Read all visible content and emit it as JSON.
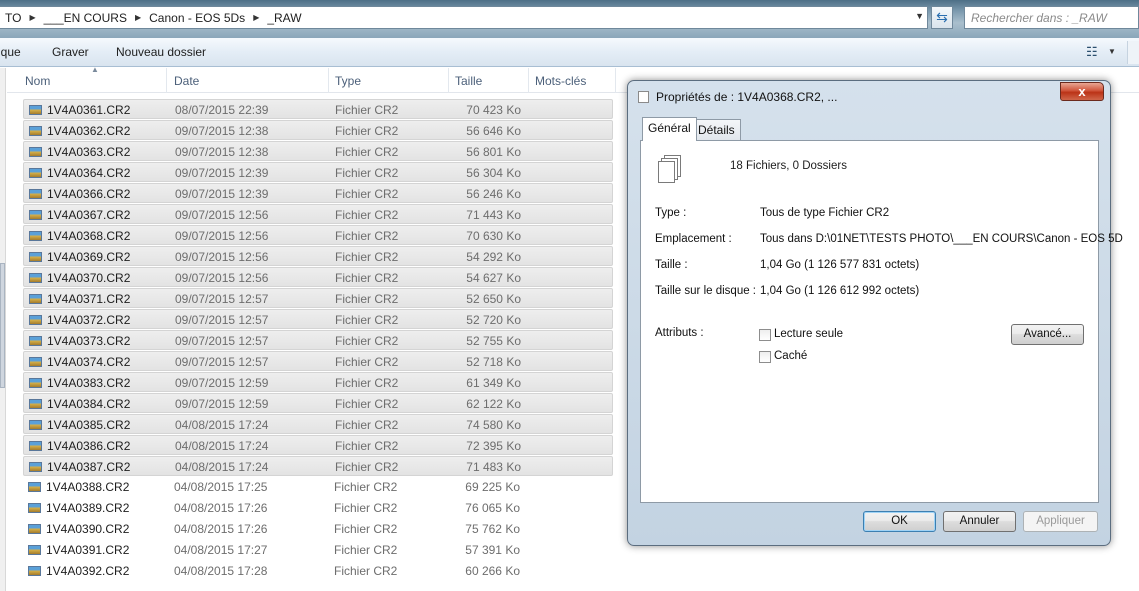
{
  "address_bar": {
    "crumbs": [
      "TO",
      "___EN COURS",
      "Canon - EOS 5Ds",
      "_RAW"
    ],
    "search_placeholder": "Rechercher dans : _RAW"
  },
  "toolbar": {
    "partial_item": "ique",
    "burn": "Graver",
    "new_folder": "Nouveau dossier"
  },
  "columns": {
    "name": "Nom",
    "date": "Date",
    "type": "Type",
    "size": "Taille",
    "tags": "Mots-clés"
  },
  "files": [
    {
      "name": "1V4A0361.CR2",
      "date": "08/07/2015 22:39",
      "type": "Fichier CR2",
      "size": "70 423 Ko",
      "selected": true
    },
    {
      "name": "1V4A0362.CR2",
      "date": "09/07/2015 12:38",
      "type": "Fichier CR2",
      "size": "56 646 Ko",
      "selected": true
    },
    {
      "name": "1V4A0363.CR2",
      "date": "09/07/2015 12:38",
      "type": "Fichier CR2",
      "size": "56 801 Ko",
      "selected": true
    },
    {
      "name": "1V4A0364.CR2",
      "date": "09/07/2015 12:39",
      "type": "Fichier CR2",
      "size": "56 304 Ko",
      "selected": true
    },
    {
      "name": "1V4A0366.CR2",
      "date": "09/07/2015 12:39",
      "type": "Fichier CR2",
      "size": "56 246 Ko",
      "selected": true
    },
    {
      "name": "1V4A0367.CR2",
      "date": "09/07/2015 12:56",
      "type": "Fichier CR2",
      "size": "71 443 Ko",
      "selected": true
    },
    {
      "name": "1V4A0368.CR2",
      "date": "09/07/2015 12:56",
      "type": "Fichier CR2",
      "size": "70 630 Ko",
      "selected": true
    },
    {
      "name": "1V4A0369.CR2",
      "date": "09/07/2015 12:56",
      "type": "Fichier CR2",
      "size": "54 292 Ko",
      "selected": true
    },
    {
      "name": "1V4A0370.CR2",
      "date": "09/07/2015 12:56",
      "type": "Fichier CR2",
      "size": "54 627 Ko",
      "selected": true
    },
    {
      "name": "1V4A0371.CR2",
      "date": "09/07/2015 12:57",
      "type": "Fichier CR2",
      "size": "52 650 Ko",
      "selected": true
    },
    {
      "name": "1V4A0372.CR2",
      "date": "09/07/2015 12:57",
      "type": "Fichier CR2",
      "size": "52 720 Ko",
      "selected": true
    },
    {
      "name": "1V4A0373.CR2",
      "date": "09/07/2015 12:57",
      "type": "Fichier CR2",
      "size": "52 755 Ko",
      "selected": true
    },
    {
      "name": "1V4A0374.CR2",
      "date": "09/07/2015 12:57",
      "type": "Fichier CR2",
      "size": "52 718 Ko",
      "selected": true
    },
    {
      "name": "1V4A0383.CR2",
      "date": "09/07/2015 12:59",
      "type": "Fichier CR2",
      "size": "61 349 Ko",
      "selected": true
    },
    {
      "name": "1V4A0384.CR2",
      "date": "09/07/2015 12:59",
      "type": "Fichier CR2",
      "size": "62 122 Ko",
      "selected": true
    },
    {
      "name": "1V4A0385.CR2",
      "date": "04/08/2015 17:24",
      "type": "Fichier CR2",
      "size": "74 580 Ko",
      "selected": true
    },
    {
      "name": "1V4A0386.CR2",
      "date": "04/08/2015 17:24",
      "type": "Fichier CR2",
      "size": "72 395 Ko",
      "selected": true
    },
    {
      "name": "1V4A0387.CR2",
      "date": "04/08/2015 17:24",
      "type": "Fichier CR2",
      "size": "71 483 Ko",
      "selected": true
    },
    {
      "name": "1V4A0388.CR2",
      "date": "04/08/2015 17:25",
      "type": "Fichier CR2",
      "size": "69 225 Ko",
      "selected": false
    },
    {
      "name": "1V4A0389.CR2",
      "date": "04/08/2015 17:26",
      "type": "Fichier CR2",
      "size": "76 065 Ko",
      "selected": false
    },
    {
      "name": "1V4A0390.CR2",
      "date": "04/08/2015 17:26",
      "type": "Fichier CR2",
      "size": "75 762 Ko",
      "selected": false
    },
    {
      "name": "1V4A0391.CR2",
      "date": "04/08/2015 17:27",
      "type": "Fichier CR2",
      "size": "57 391 Ko",
      "selected": false
    },
    {
      "name": "1V4A0392.CR2",
      "date": "04/08/2015 17:28",
      "type": "Fichier CR2",
      "size": "60 266 Ko",
      "selected": false
    }
  ],
  "dialog": {
    "title": "Propriétés de : 1V4A0368.CR2, ...",
    "close": "x",
    "tabs": [
      "Général",
      "Détails"
    ],
    "summary": "18 Fichiers, 0 Dossiers",
    "props": [
      {
        "label": "Type :",
        "value": "Tous de type Fichier CR2"
      },
      {
        "label": "Emplacement :",
        "value": "Tous dans D:\\01NET\\TESTS PHOTO\\___EN COURS\\Canon - EOS 5D"
      },
      {
        "label": "Taille :",
        "value": "1,04 Go (1 126 577 831 octets)"
      },
      {
        "label": "Taille sur le disque :",
        "value": "1,04 Go (1 126 612 992 octets)"
      }
    ],
    "attributes_label": "Attributs :",
    "readonly": "Lecture seule",
    "hidden": "Caché",
    "advanced": "Avancé...",
    "ok": "OK",
    "cancel": "Annuler",
    "apply": "Appliquer"
  }
}
